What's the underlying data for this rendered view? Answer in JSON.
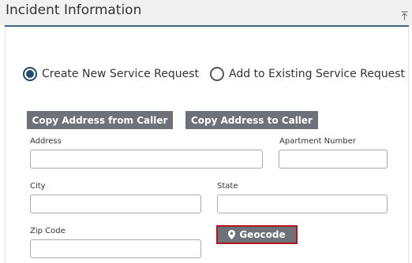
{
  "panel": {
    "title": "Incident Information",
    "collapse_icon": "collapse-up-icon"
  },
  "request_mode": {
    "options": [
      {
        "label": "Create New Service Request",
        "selected": true
      },
      {
        "label": "Add to Existing Service Request",
        "selected": false
      }
    ]
  },
  "address_buttons": {
    "copy_from_caller": "Copy Address from Caller",
    "copy_to_caller": "Copy Address to Caller"
  },
  "fields": {
    "address": {
      "label": "Address",
      "value": ""
    },
    "apartment": {
      "label": "Apartment Number",
      "value": ""
    },
    "city": {
      "label": "City",
      "value": ""
    },
    "state": {
      "label": "State",
      "value": ""
    },
    "zip": {
      "label": "Zip Code",
      "value": ""
    }
  },
  "geocode": {
    "label": "Geocode",
    "icon": "map-marker-icon"
  },
  "colors": {
    "header_rule": "#3f6681",
    "radio_selected": "#1f4e6b",
    "button_bg": "#6d7178",
    "focus_border": "#b2151b"
  }
}
